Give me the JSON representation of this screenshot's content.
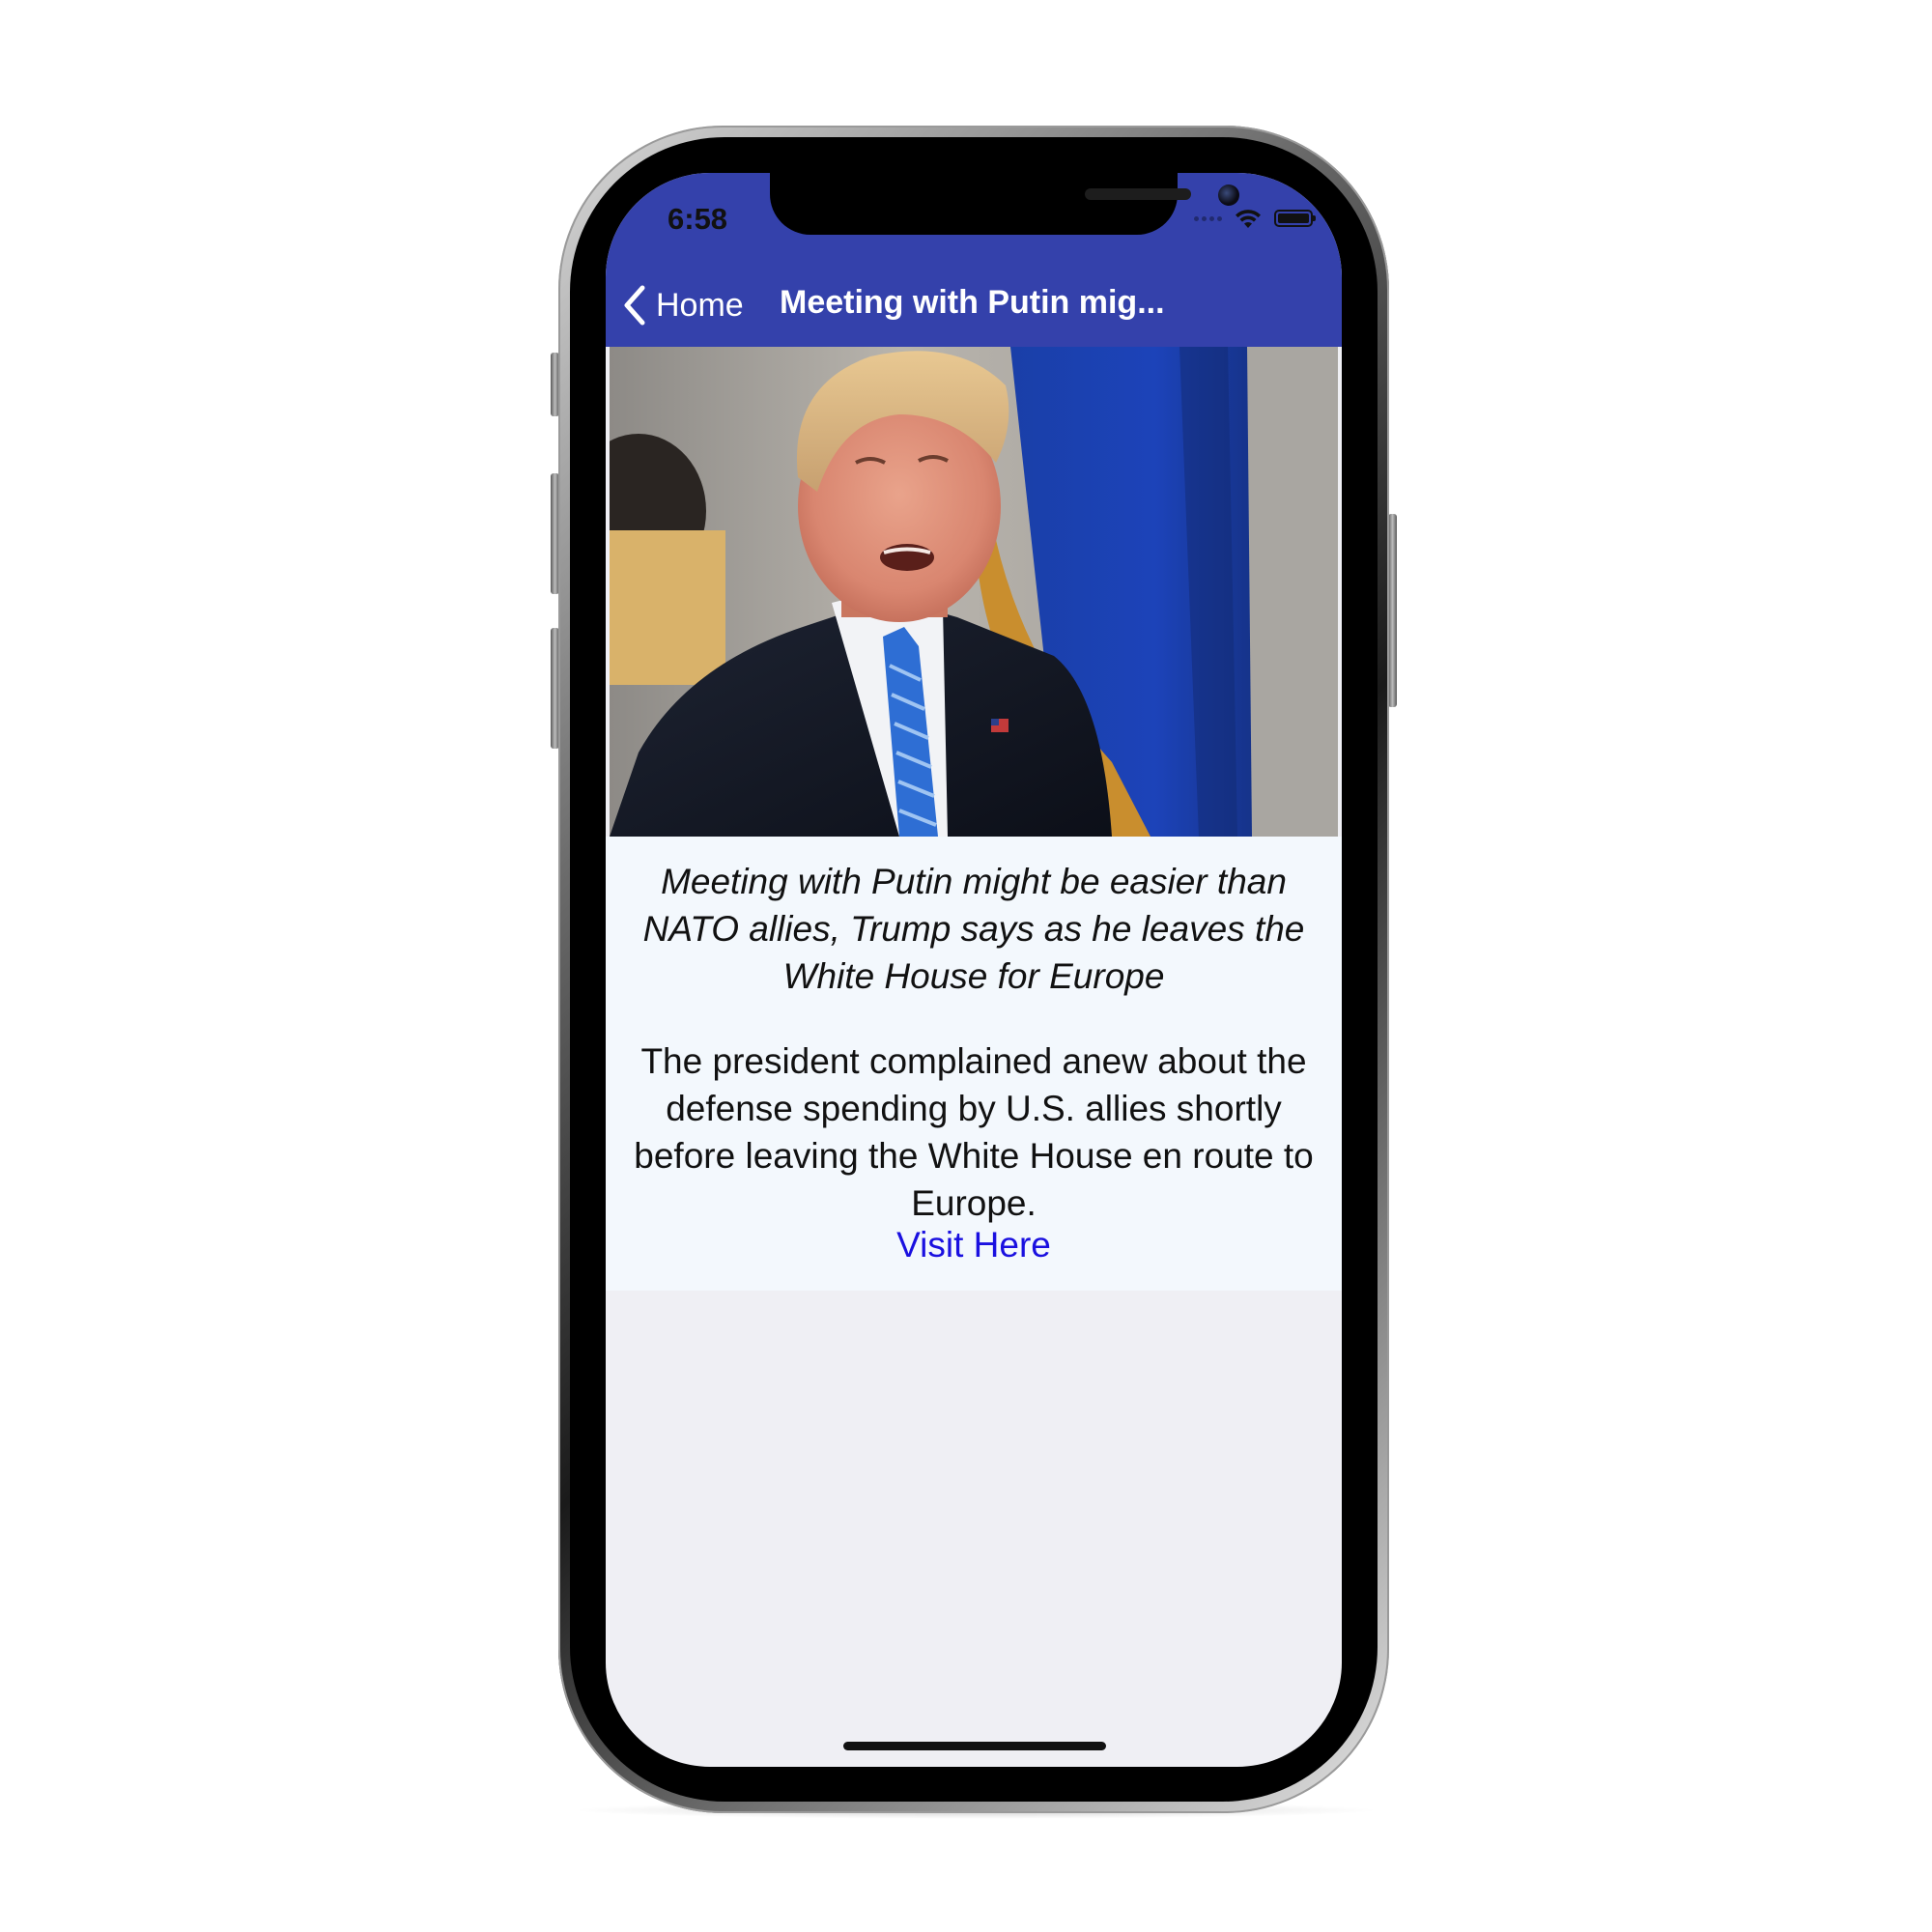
{
  "status_bar": {
    "time": "6:58"
  },
  "nav_bar": {
    "background_color": "#3441ab",
    "back_label": "Home",
    "title": "Meeting with Putin mig..."
  },
  "article": {
    "image_description_icon": "news-photo",
    "headline": "Meeting with Putin might be easier than NATO allies, Trump says as he leaves the White House for Europe",
    "summary": "The president complained anew about the defense spending by U.S. allies shortly before leaving the White House en route to Europe.",
    "link_label": "Visit Here",
    "link_color": "#1a10e0",
    "body_background": "#f3f8fd"
  },
  "screen_background": "#efeff4"
}
